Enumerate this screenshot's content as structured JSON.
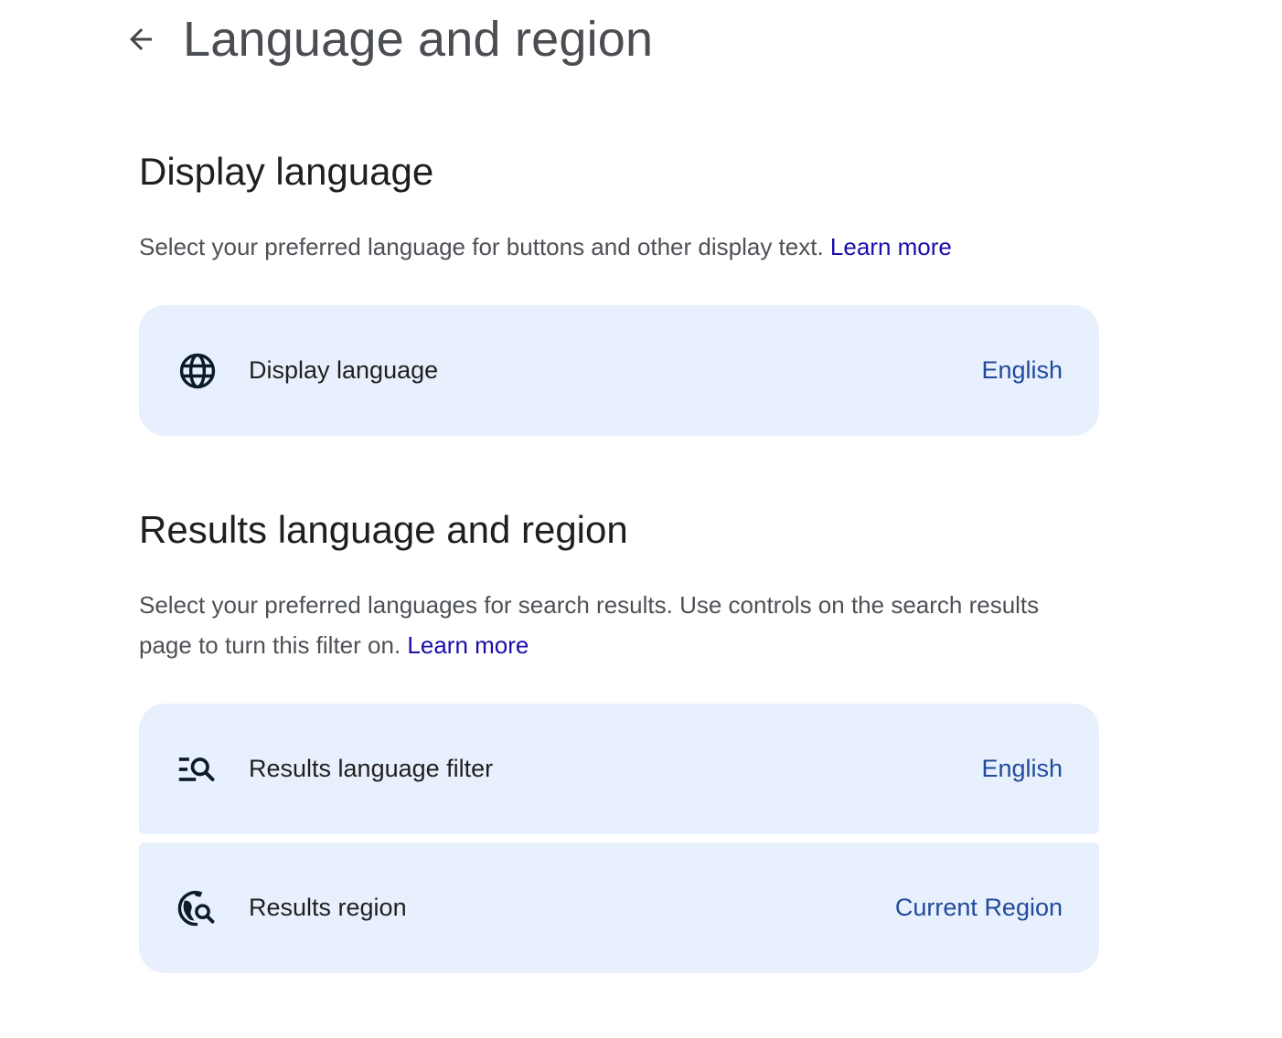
{
  "header": {
    "title": "Language and region"
  },
  "display_section": {
    "title": "Display language",
    "description": "Select your preferred language for buttons and other display text.",
    "learn_more": "Learn more",
    "items": [
      {
        "label": "Display language",
        "value": "English",
        "icon": "globe-icon"
      }
    ]
  },
  "results_section": {
    "title": "Results language and region",
    "description": "Select your preferred languages for search results. Use controls on the search results page to turn this filter on.",
    "learn_more": "Learn more",
    "items": [
      {
        "label": "Results language filter",
        "value": "English",
        "icon": "filter-search-icon"
      },
      {
        "label": "Results region",
        "value": "Current Region",
        "icon": "globe-search-icon"
      }
    ]
  },
  "colors": {
    "card_background": "#e9f0fd",
    "link": "#1a0dab",
    "value_text": "#1f4a9c"
  }
}
